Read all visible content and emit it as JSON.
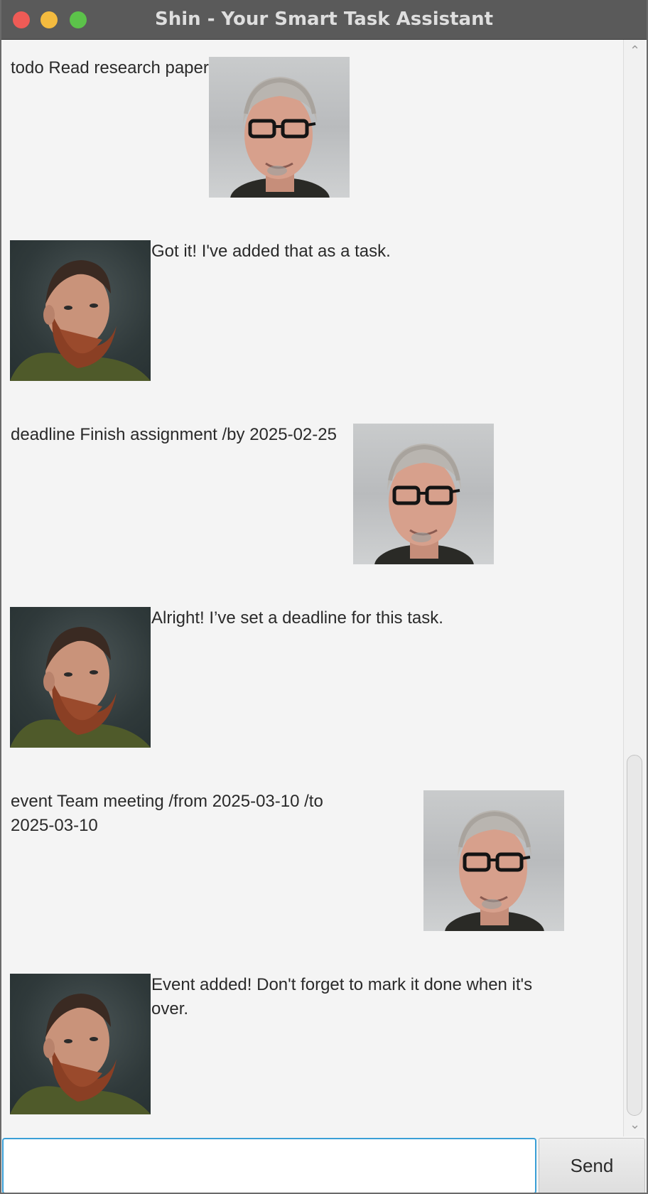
{
  "window": {
    "title": "Shin - Your Smart Task Assistant"
  },
  "chat": {
    "messages": [
      {
        "from": "user",
        "text": "todo Read research paper"
      },
      {
        "from": "bot",
        "text": "Got it! I've added that as a task."
      },
      {
        "from": "user",
        "text": "deadline Finish assignment /by 2025-02-25"
      },
      {
        "from": "bot",
        "text": "Alright! I’ve set a deadline for this task."
      },
      {
        "from": "user",
        "text": "event Team meeting /from 2025-03-10 /to 2025-03-10"
      },
      {
        "from": "bot",
        "text": "Event added! Don't forget to mark it done when it's over."
      }
    ]
  },
  "input": {
    "value": "",
    "placeholder": ""
  },
  "send_button": {
    "label": "Send"
  },
  "icons": {
    "scroll_up": "chevron-up-icon",
    "scroll_down": "chevron-down-icon"
  },
  "colors": {
    "titlebar": "#5a5a5a",
    "close": "#ee5b56",
    "minimize": "#f4bb3f",
    "maximize": "#5cc24a",
    "input_focus": "#3a9fd6",
    "background": "#f4f4f4"
  }
}
